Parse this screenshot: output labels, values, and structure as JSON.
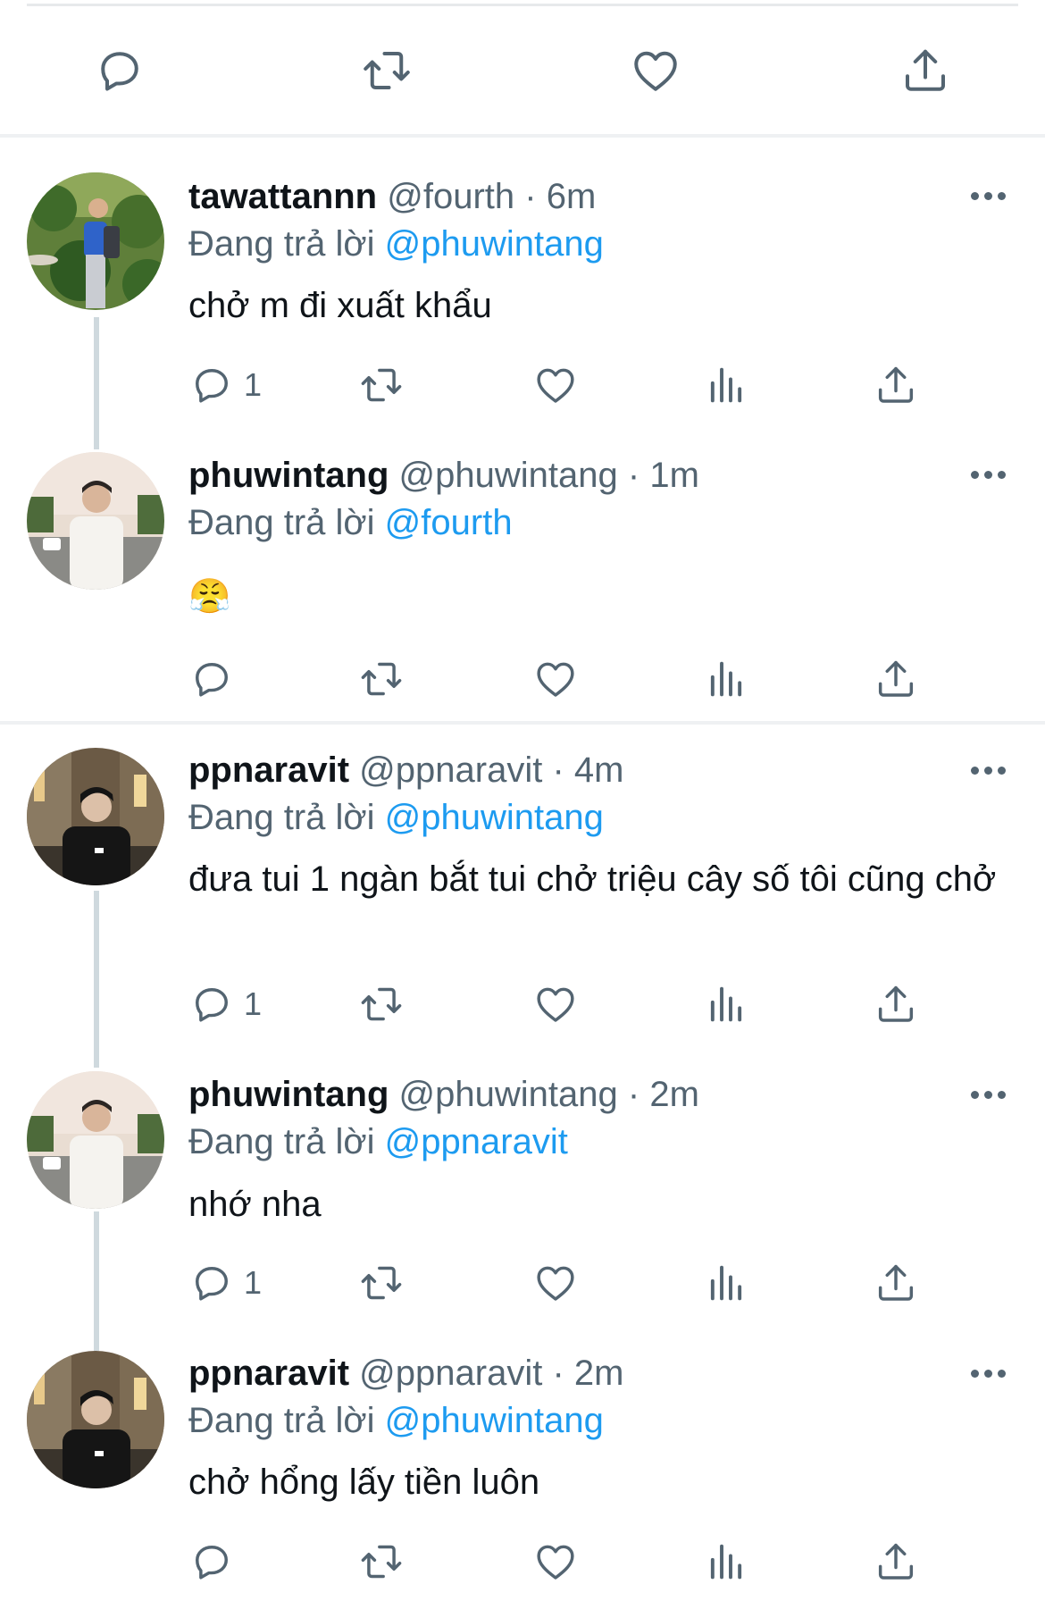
{
  "tweets": [
    {
      "name": "tawattannn",
      "handle": "@fourth",
      "time": "6m",
      "reply_prefix": "Đang trả lời",
      "reply_to": "@phuwintang",
      "text": "chở m đi xuất khẩu",
      "reply_count": "1"
    },
    {
      "name": "phuwintang",
      "handle": "@phuwintang",
      "time": "1m",
      "reply_prefix": "Đang trả lời",
      "reply_to": "@fourth",
      "text": "😤",
      "reply_count": ""
    },
    {
      "name": "ppnaravit",
      "handle": "@ppnaravit",
      "time": "4m",
      "reply_prefix": "Đang trả lời",
      "reply_to": "@phuwintang",
      "text": "đưa tui 1 ngàn bắt tui chở triệu cây số tôi cũng chở",
      "reply_count": "1"
    },
    {
      "name": "phuwintang",
      "handle": "@phuwintang",
      "time": "2m",
      "reply_prefix": "Đang trả lời",
      "reply_to": "@ppnaravit",
      "text": "nhớ nha",
      "reply_count": "1"
    },
    {
      "name": "ppnaravit",
      "handle": "@ppnaravit",
      "time": "2m",
      "reply_prefix": "Đang trả lời",
      "reply_to": "@phuwintang",
      "text": "chở hổng lấy tiền luôn",
      "reply_count": ""
    }
  ],
  "separator": "·",
  "icons": {
    "reply": "speech-bubble-icon",
    "retweet": "retweet-arrows-icon",
    "like": "heart-icon",
    "views": "bar-chart-icon",
    "share": "share-upload-icon",
    "more": "ellipsis-icon"
  },
  "colors": {
    "link": "#1d9bf0",
    "muted": "#536471",
    "text": "#0f1419",
    "divider": "#eff1f3"
  }
}
